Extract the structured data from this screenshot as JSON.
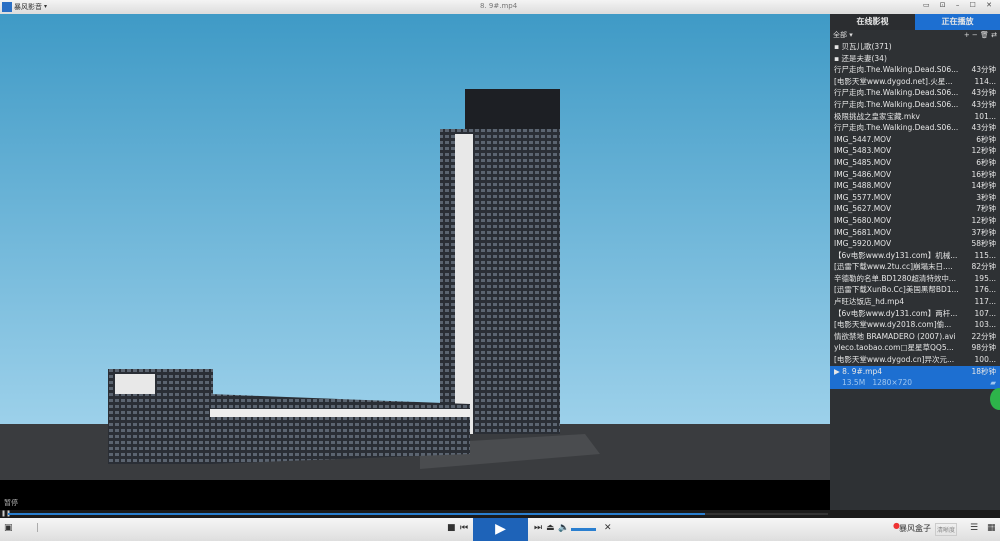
{
  "app": {
    "name": "暴风影音",
    "file_title": "8. 9#.mp4",
    "window_buttons": "▭ ⊡ – ☐ ✕"
  },
  "panel": {
    "tabs": [
      "在线影视",
      "正在播放"
    ],
    "filter": "全部 ▾",
    "tool_icons": "+ − 🗑 ⇄",
    "groups": [
      "贝瓦儿歌(371)",
      "还是夫妻(34)"
    ],
    "items": [
      {
        "name": "行尸走肉.The.Walking.Dead.S06...",
        "dur": "43分钟"
      },
      {
        "name": "[电影天堂www.dygod.net].火星...",
        "dur": "114..."
      },
      {
        "name": "行尸走肉.The.Walking.Dead.S06...",
        "dur": "43分钟"
      },
      {
        "name": "行尸走肉.The.Walking.Dead.S06...",
        "dur": "43分钟"
      },
      {
        "name": "极限挑战之皇家宝藏.mkv",
        "dur": "101..."
      },
      {
        "name": "行尸走肉.The.Walking.Dead.S06...",
        "dur": "43分钟"
      },
      {
        "name": "IMG_5447.MOV",
        "dur": "6秒钟"
      },
      {
        "name": "IMG_5483.MOV",
        "dur": "12秒钟"
      },
      {
        "name": "IMG_5485.MOV",
        "dur": "6秒钟"
      },
      {
        "name": "IMG_5486.MOV",
        "dur": "16秒钟"
      },
      {
        "name": "IMG_5488.MOV",
        "dur": "14秒钟"
      },
      {
        "name": "IMG_5577.MOV",
        "dur": "3秒钟"
      },
      {
        "name": "IMG_5627.MOV",
        "dur": "7秒钟"
      },
      {
        "name": "IMG_5680.MOV",
        "dur": "12秒钟"
      },
      {
        "name": "IMG_5681.MOV",
        "dur": "37秒钟"
      },
      {
        "name": "IMG_5920.MOV",
        "dur": "58秒钟"
      },
      {
        "name": "【6v电影www.dy131.com】机械...",
        "dur": "115..."
      },
      {
        "name": "[迅雷下载www.2tu.cc]崩塌末日....",
        "dur": "82分钟"
      },
      {
        "name": "辛德勒的名单.BD1280超清特效中...",
        "dur": "195..."
      },
      {
        "name": "[迅雷下载XunBo.Cc]美国黑帮BD1...",
        "dur": "176..."
      },
      {
        "name": "卢旺达饭店_hd.mp4",
        "dur": "117..."
      },
      {
        "name": "【6v电影www.dy131.com】两杆...",
        "dur": "107..."
      },
      {
        "name": "[电影天堂www.dy2018.com]偷...",
        "dur": "103..."
      },
      {
        "name": "情欲禁地 BRAMADERO (2007).avi",
        "dur": "22分钟"
      },
      {
        "name": "yleco.taobao.com□星星草QQ5...",
        "dur": "98分钟"
      },
      {
        "name": "[电影天堂www.dygod.cn]异次元...",
        "dur": "100..."
      }
    ],
    "current": {
      "name": "8. 9#.mp4",
      "dur": "18秒钟",
      "size": "13.5M",
      "resolution": "1280×720"
    }
  },
  "player": {
    "status": "暂停",
    "progress": 0.85,
    "volume": 0.7,
    "brand_button": "暴风盒子",
    "clear_button": "清晰度"
  }
}
